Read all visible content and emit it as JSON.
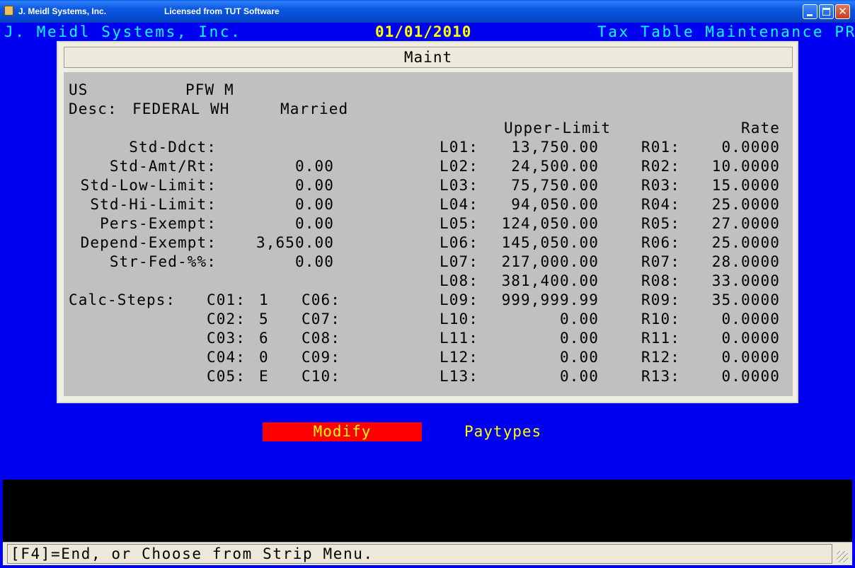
{
  "window": {
    "title_left": "J. Meidl Systems, Inc.",
    "title_right": "Licensed from TUT Software"
  },
  "header": {
    "company": "J. Meidl Systems, Inc.",
    "date": "01/01/2010",
    "title": "Tax Table Maintenance PR"
  },
  "panel": {
    "heading": "Maint",
    "jurisdiction": "US",
    "code": "PFW M",
    "desc_label": "Desc:",
    "desc_value": "FEDERAL WH",
    "status": "Married",
    "col_upper": "Upper-Limit",
    "col_rate": "Rate",
    "fields": [
      {
        "label": "Std-Ddct:",
        "value": ""
      },
      {
        "label": "Std-Amt/Rt:",
        "value": "0.00"
      },
      {
        "label": "Std-Low-Limit:",
        "value": "0.00"
      },
      {
        "label": "Std-Hi-Limit:",
        "value": "0.00"
      },
      {
        "label": "Pers-Exempt:",
        "value": "0.00"
      },
      {
        "label": "Depend-Exempt:",
        "value": "3,650.00"
      },
      {
        "label": "Str-Fed-%%:",
        "value": "0.00"
      }
    ],
    "calc_label": "Calc-Steps:",
    "calc_steps": [
      {
        "label": "C01:",
        "value": "1"
      },
      {
        "label": "C02:",
        "value": "5"
      },
      {
        "label": "C03:",
        "value": "6"
      },
      {
        "label": "C04:",
        "value": "0"
      },
      {
        "label": "C05:",
        "value": "E"
      },
      {
        "label": "C06:",
        "value": ""
      },
      {
        "label": "C07:",
        "value": ""
      },
      {
        "label": "C08:",
        "value": ""
      },
      {
        "label": "C09:",
        "value": ""
      },
      {
        "label": "C10:",
        "value": ""
      }
    ],
    "limits": [
      {
        "label": "L01:",
        "value": "13,750.00",
        "rlabel": "R01:",
        "rate": "0.0000"
      },
      {
        "label": "L02:",
        "value": "24,500.00",
        "rlabel": "R02:",
        "rate": "10.0000"
      },
      {
        "label": "L03:",
        "value": "75,750.00",
        "rlabel": "R03:",
        "rate": "15.0000"
      },
      {
        "label": "L04:",
        "value": "94,050.00",
        "rlabel": "R04:",
        "rate": "25.0000"
      },
      {
        "label": "L05:",
        "value": "124,050.00",
        "rlabel": "R05:",
        "rate": "27.0000"
      },
      {
        "label": "L06:",
        "value": "145,050.00",
        "rlabel": "R06:",
        "rate": "25.0000"
      },
      {
        "label": "L07:",
        "value": "217,000.00",
        "rlabel": "R07:",
        "rate": "28.0000"
      },
      {
        "label": "L08:",
        "value": "381,400.00",
        "rlabel": "R08:",
        "rate": "33.0000"
      },
      {
        "label": "L09:",
        "value": "999,999.99",
        "rlabel": "R09:",
        "rate": "35.0000"
      },
      {
        "label": "L10:",
        "value": "0.00",
        "rlabel": "R10:",
        "rate": "0.0000"
      },
      {
        "label": "L11:",
        "value": "0.00",
        "rlabel": "R11:",
        "rate": "0.0000"
      },
      {
        "label": "L12:",
        "value": "0.00",
        "rlabel": "R12:",
        "rate": "0.0000"
      },
      {
        "label": "L13:",
        "value": "0.00",
        "rlabel": "R13:",
        "rate": "0.0000"
      }
    ]
  },
  "menu": {
    "modify": "Modify",
    "paytypes": "Paytypes"
  },
  "status": {
    "text": "[F4]=End, or Choose from Strip Menu."
  },
  "colors": {
    "background": "#0000f0",
    "header_text": "#00ffff",
    "date_text": "#ffff00",
    "menu_highlight": "#ff0000",
    "menu_text": "#ffff00"
  },
  "icons": [
    "app-icon",
    "minimize-icon",
    "maximize-icon",
    "close-icon",
    "resize-grip-icon"
  ]
}
